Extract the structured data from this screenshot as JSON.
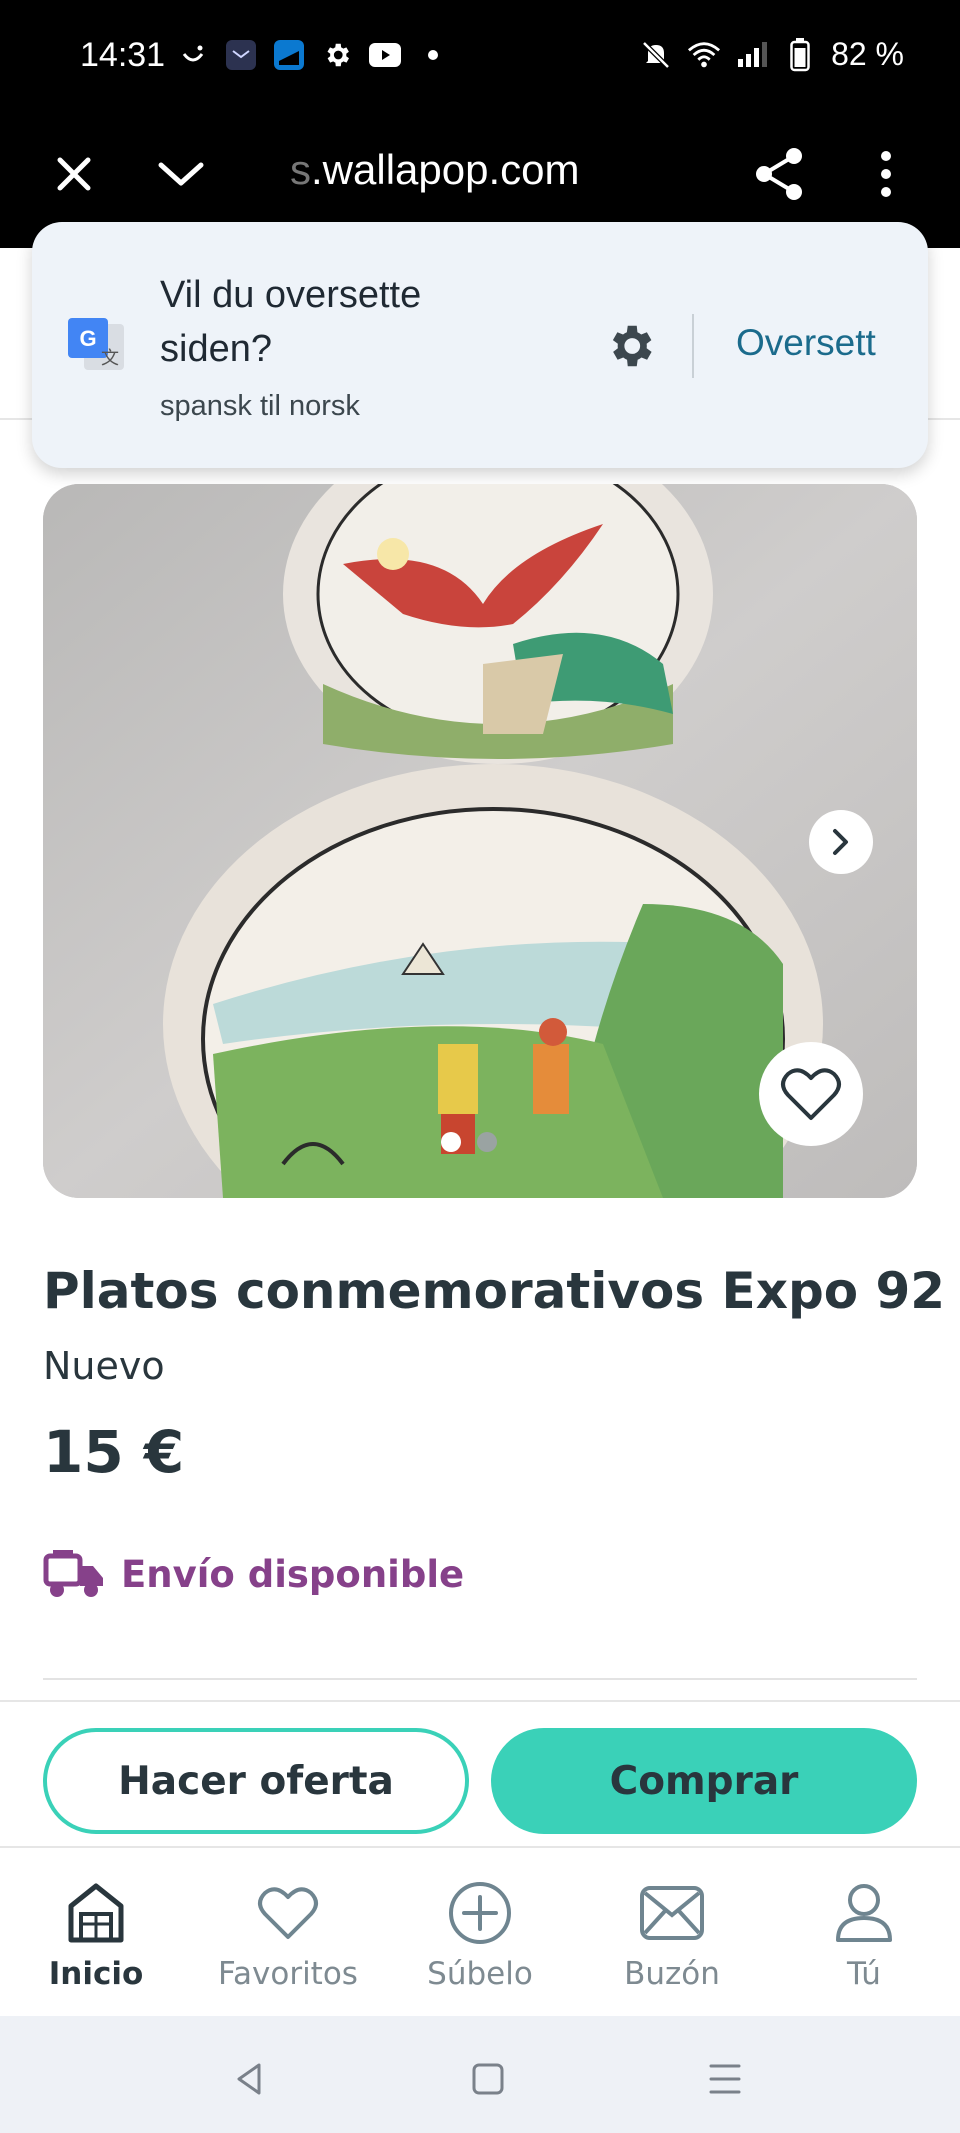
{
  "status_bar": {
    "time": "14:31",
    "battery": "82 %",
    "left_icons": [
      "smile-icon",
      "mail-app-icon",
      "app-icon",
      "gear-icon",
      "youtube-icon",
      "dot-icon"
    ],
    "right_icons": [
      "mute-icon",
      "wifi-icon",
      "signal-icon",
      "battery-icon"
    ]
  },
  "browser": {
    "url_faded": "s",
    "url": ".wallapop.com",
    "icons": [
      "close-icon",
      "chevron-down-icon",
      "share-icon",
      "more-vert-icon"
    ]
  },
  "translate_prompt": {
    "title": "Vil du oversette siden?",
    "subtitle": "spansk til norsk",
    "action": "Oversett",
    "icons": [
      "google-translate-icon",
      "gear-icon"
    ]
  },
  "product": {
    "title": "Platos conmemorativos Expo 92",
    "condition": "Nuevo",
    "price": "15 €",
    "shipping": "Envío disponible",
    "image_dots": 2,
    "active_image_index": 0
  },
  "actions": {
    "offer": "Hacer oferta",
    "buy": "Comprar"
  },
  "bottom_nav": {
    "items": [
      {
        "label": "Inicio",
        "icon": "home-icon",
        "active": true
      },
      {
        "label": "Favoritos",
        "icon": "heart-icon",
        "active": false
      },
      {
        "label": "Súbelo",
        "icon": "plus-circle-icon",
        "active": false
      },
      {
        "label": "Buzón",
        "icon": "mail-icon",
        "active": false
      },
      {
        "label": "Tú",
        "icon": "user-icon",
        "active": false
      }
    ]
  },
  "colors": {
    "accent": "#3ad1b8",
    "shipping": "#86418a",
    "text": "#29363d",
    "translate_action": "#1b6b8c"
  }
}
